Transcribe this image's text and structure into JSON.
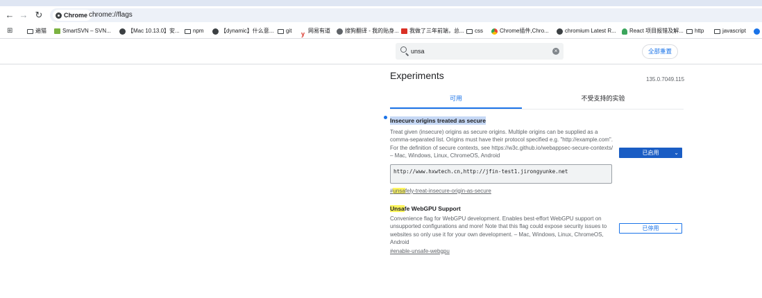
{
  "browser": {
    "nav": {
      "back": "←",
      "forward": "→",
      "reload": "↻"
    },
    "chip_label": "Chrome",
    "url": "chrome://flags"
  },
  "bookmarks": [
    {
      "label": "遍猫",
      "icon": "folder-icon"
    },
    {
      "label": "SmartSVN – SVN...",
      "icon": "smartsvn-icon"
    },
    {
      "label": "【Mac 10.13.0】安...",
      "icon": "globe-icon"
    },
    {
      "label": "npm",
      "icon": "folder-icon"
    },
    {
      "label": "【dynamic】什么意...",
      "icon": "globe-icon"
    },
    {
      "label": "git",
      "icon": "folder-icon"
    },
    {
      "label": "网易有道",
      "icon": "youdao-icon"
    },
    {
      "label": "搜狗翻译 - 我的贴身...",
      "icon": "sogou-icon"
    },
    {
      "label": "我做了三年前端，总...",
      "icon": "juejin-icon"
    },
    {
      "label": "css",
      "icon": "folder-icon"
    },
    {
      "label": "Chrome插件,Chro...",
      "icon": "chrome-icon"
    },
    {
      "label": "chromium Latest R...",
      "icon": "globe-icon"
    },
    {
      "label": "React 项目报错及解...",
      "icon": "react-icon"
    },
    {
      "label": "http",
      "icon": "folder-icon"
    },
    {
      "label": "javascript",
      "icon": "folder-icon"
    }
  ],
  "flags_page": {
    "search_value": "unsa",
    "reset_label": "全部重置",
    "title": "Experiments",
    "version": "135.0.7049.115",
    "tab_available": "可用",
    "tab_unavailable": "不受支持的实验",
    "flags": [
      {
        "name": "Insecure origins treated as secure",
        "description": "Treat given (insecure) origins as secure origins. Multiple origins can be supplied as a comma-separated list. Origins must have their protocol specified e.g. \"http://example.com\". For the definition of secure contexts, see https://w3c.github.io/webappsec-secure-contexts/ – Mac, Windows, Linux, ChromeOS, Android",
        "origins_value": "http://www.hxwtech.cn,http://jfin-test1.jirongyunke.net",
        "link_prefix": "#",
        "link_match": "unsa",
        "link_rest": "fely-treat-insecure-origin-as-secure",
        "state": "已启用"
      },
      {
        "name_match": "Unsa",
        "name_rest": "fe WebGPU Support",
        "description": "Convenience flag for WebGPU development. Enables best-effort WebGPU support on unsupported configurations and more! Note that this flag could expose security issues to websites so only use it for your own development. – Mac, Windows, Linux, ChromeOS, Android",
        "link": "#enable-unsafe-webgpu",
        "state": "已停用"
      }
    ]
  }
}
